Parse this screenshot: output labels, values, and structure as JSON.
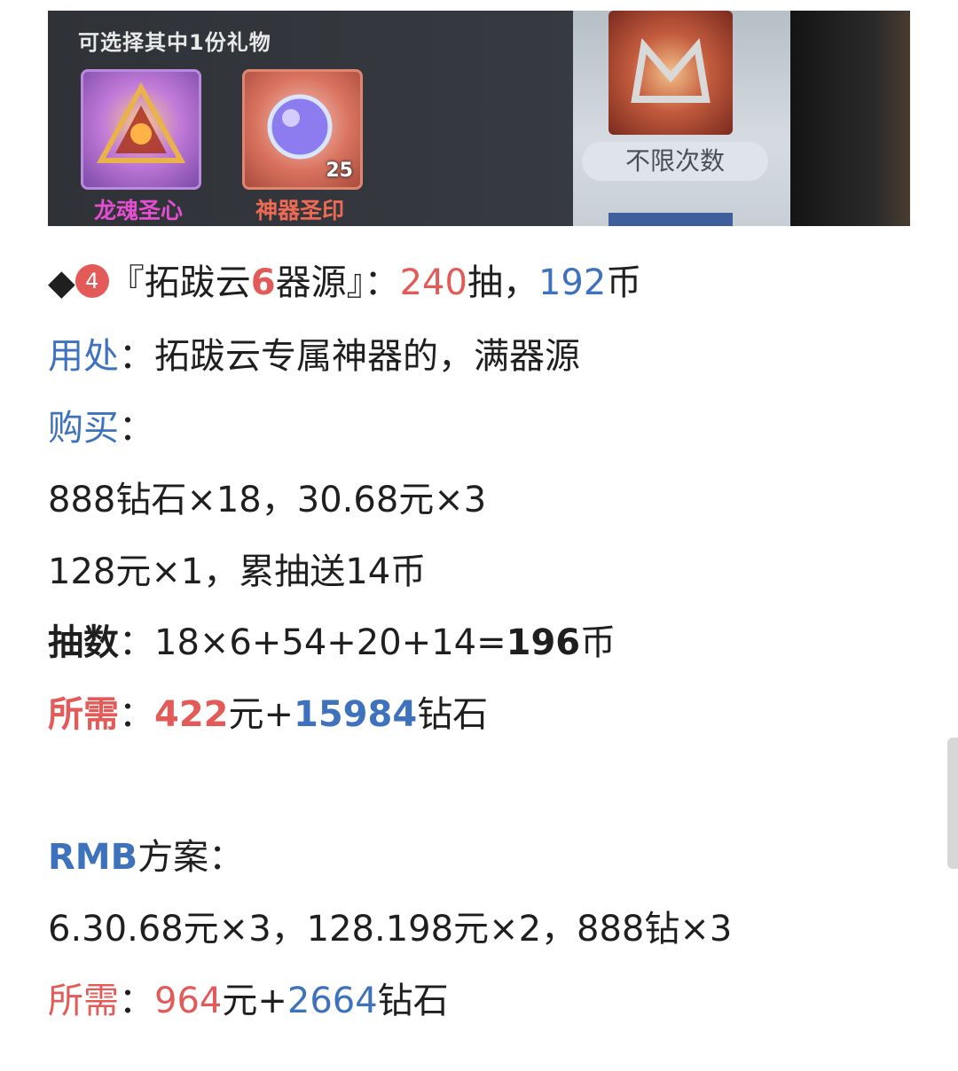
{
  "banner": {
    "title": "可选择其中1份礼物",
    "gifts": [
      {
        "name": "龙魂圣心",
        "qty": ""
      },
      {
        "name": "神器圣印",
        "qty": "25"
      }
    ],
    "side_badge": "不限次数"
  },
  "heading": {
    "bullet": "◆",
    "num": "4",
    "open": "『拓跋云",
    "count": "6",
    "close": "器源』：",
    "draws": "240",
    "draws_unit": "抽，",
    "coins": "192",
    "coins_unit": "币"
  },
  "usage": {
    "label": "用处",
    "text": "：拓跋云专属神器的，满器源"
  },
  "buy": {
    "label": "购买",
    "text": "："
  },
  "buy_line1": "888钻石×18，30.68元×3",
  "buy_line2": "128元×1，累抽送14币",
  "draw_count": {
    "label": "抽数",
    "expr": "：18×6+54+20+14=",
    "total": "196",
    "unit": "币"
  },
  "need1": {
    "label": "所需",
    "colon": "：",
    "rmb": "422",
    "rmb_unit": "元+",
    "diamond": "15984",
    "diamond_unit": "钻石"
  },
  "rmb_plan": {
    "label": "RMB",
    "text": "方案："
  },
  "plan_line": "6.30.68元×3，128.198元×2，888钻×3",
  "need2": {
    "label": "所需",
    "colon": "：",
    "rmb": "964",
    "rmb_unit": "元+",
    "diamond": "2664",
    "diamond_unit": "钻石"
  },
  "colors": {
    "red": "#e25b58",
    "blue": "#3f72bd"
  }
}
